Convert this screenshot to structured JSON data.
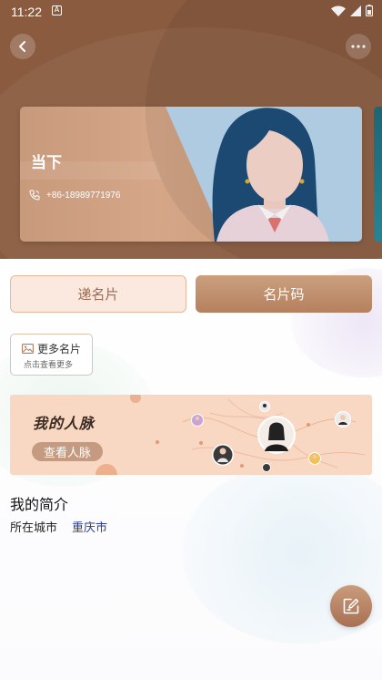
{
  "status_bar": {
    "time": "11:22",
    "notification_icon": "A"
  },
  "header": {
    "back_icon": "chevron-left-icon",
    "more_icon": "ellipsis-icon"
  },
  "card": {
    "name": "当下",
    "phone": "+86-18989771976",
    "phone_icon": "phone-icon"
  },
  "tabs": [
    {
      "label": "递名片"
    },
    {
      "label": "名片码"
    }
  ],
  "more_cards": {
    "title": "更多名片",
    "subtitle": "点击查看更多"
  },
  "network_banner": {
    "title": "我的人脉",
    "button_label": "查看人脉"
  },
  "intro": {
    "title": "我的简介",
    "city_label": "所在城市",
    "city_value": "重庆市"
  },
  "colors": {
    "accent": "#b6805e",
    "hero_bg": "#8a5b3f",
    "city_link": "#2a3c8f"
  }
}
